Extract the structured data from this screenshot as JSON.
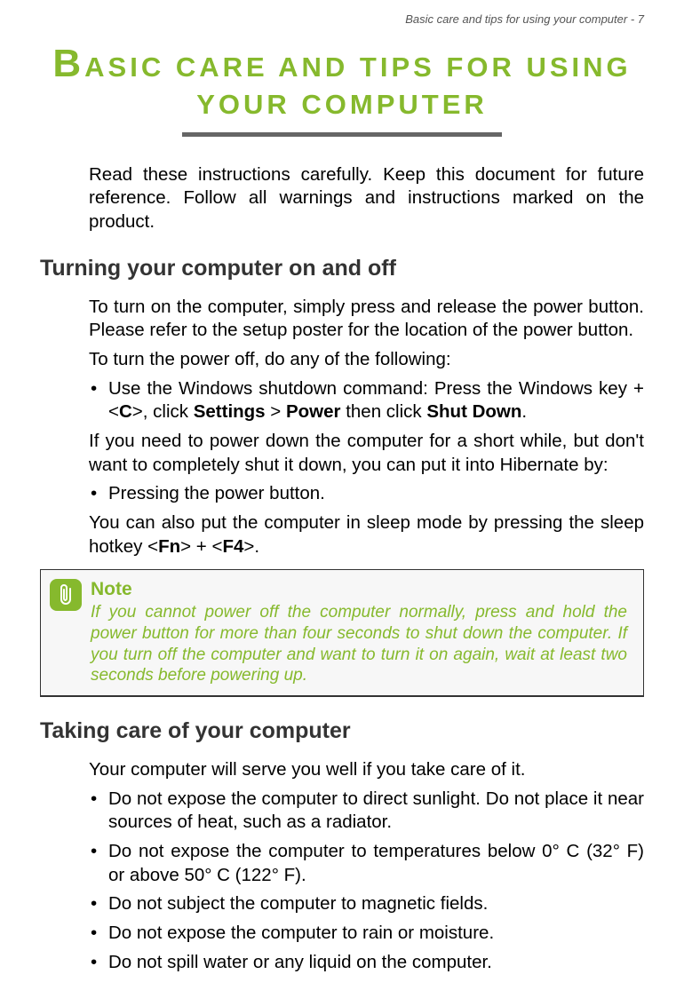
{
  "header": "Basic care and tips for using your computer - 7",
  "title_dropcap": "B",
  "title_rest": "ASIC CARE AND TIPS FOR USING YOUR COMPUTER",
  "intro": "Read these instructions carefully. Keep this document for future reference. Follow all warnings and instructions marked on the product.",
  "section1": {
    "heading": "Turning your computer on and off",
    "p1": "To turn on the computer, simply press and release the power button. Please refer to the setup poster for the location of the power button.",
    "p2": "To turn the power off, do any of the following:",
    "bullet1_pre": "Use the Windows shutdown command: Press the Windows key + <",
    "bullet1_key1": "C",
    "bullet1_mid1": ">, click ",
    "bullet1_bold1": "Settings",
    "bullet1_mid2": " > ",
    "bullet1_bold2": "Power",
    "bullet1_mid3": " then click ",
    "bullet1_bold3": "Shut Down",
    "bullet1_end": ".",
    "p3": "If you need to power down the computer for a short while, but don't want to completely shut it down, you can put it into Hibernate by:",
    "bullet2": "Pressing the power button.",
    "p4_pre": "You can also put the computer in sleep mode by pressing the sleep hotkey <",
    "p4_key1": "Fn",
    "p4_mid": "> + <",
    "p4_key2": "F4",
    "p4_end": ">."
  },
  "note": {
    "title": "Note",
    "body": "If you cannot power off the computer normally, press and hold the power button for more than four seconds to shut down the computer. If you turn off the computer and want to turn it on again, wait at least two seconds before powering up."
  },
  "section2": {
    "heading": "Taking care of your computer",
    "p1": "Your computer will serve you well if you take care of it.",
    "bullets": [
      "Do not expose the computer to direct sunlight. Do not place it near sources of heat, such as a radiator.",
      "Do not expose the computer to temperatures below 0° C (32° F) or above 50° C (122° F).",
      "Do not subject the computer to magnetic fields.",
      "Do not expose the computer to rain or moisture.",
      "Do not spill water or any liquid on the computer."
    ]
  }
}
